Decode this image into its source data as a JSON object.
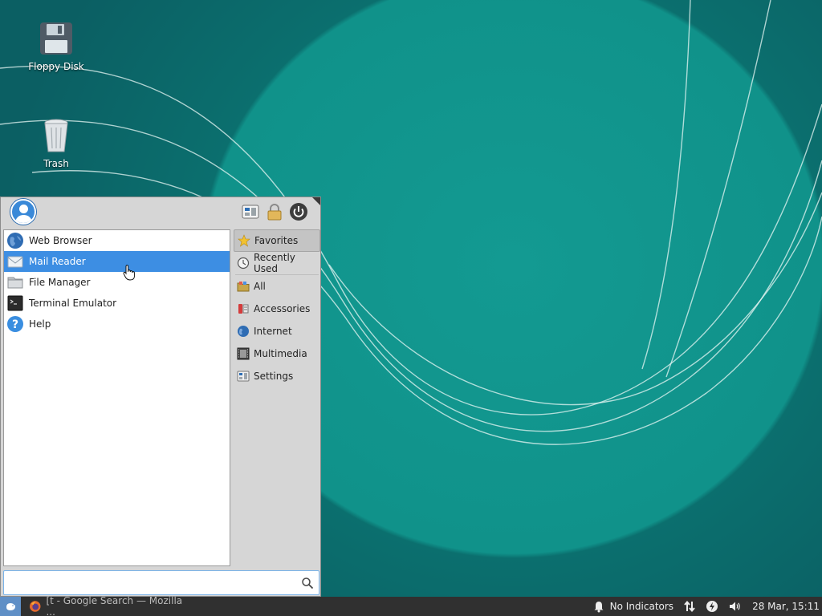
{
  "desktop": {
    "icons": [
      {
        "label": "Floppy Disk",
        "icon": "floppy-disk-icon"
      },
      {
        "label": "Trash",
        "icon": "trash-icon"
      }
    ]
  },
  "menu": {
    "header": {
      "buttons": [
        {
          "icon": "settings-manager-icon"
        },
        {
          "icon": "lock-icon"
        },
        {
          "icon": "power-icon"
        }
      ]
    },
    "apps": [
      {
        "label": "Web Browser",
        "icon": "web-browser-icon",
        "selected": false
      },
      {
        "label": "Mail Reader",
        "icon": "mail-reader-icon",
        "selected": true
      },
      {
        "label": "File Manager",
        "icon": "file-manager-icon",
        "selected": false
      },
      {
        "label": "Terminal Emulator",
        "icon": "terminal-icon",
        "selected": false
      },
      {
        "label": "Help",
        "icon": "help-icon",
        "selected": false
      }
    ],
    "categories": [
      {
        "label": "Favorites",
        "icon": "star-icon",
        "active": true
      },
      {
        "label": "Recently Used",
        "icon": "history-icon",
        "active": false
      },
      {
        "label": "All",
        "icon": "folder-icon",
        "active": false
      },
      {
        "label": "Accessories",
        "icon": "accessories-icon",
        "active": false
      },
      {
        "label": "Internet",
        "icon": "globe-icon",
        "active": false
      },
      {
        "label": "Multimedia",
        "icon": "multimedia-icon",
        "active": false
      },
      {
        "label": "Settings",
        "icon": "settings-icon",
        "active": false
      }
    ],
    "search": {
      "value": "",
      "placeholder": ""
    }
  },
  "taskbar": {
    "task_label": "[t - Google Search — Mozilla ...",
    "task_icon": "firefox-icon",
    "indicators_label": "No Indicators",
    "clock": "28 Mar, 15:11"
  },
  "colors": {
    "accent": "#3d8ee3",
    "desktop_teal": "#139a92",
    "taskbar": "#303030"
  }
}
